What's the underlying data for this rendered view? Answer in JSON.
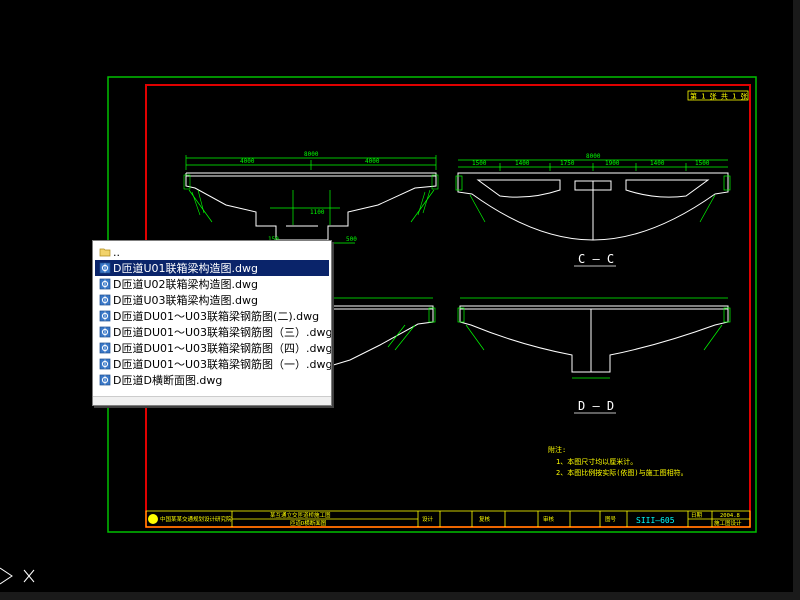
{
  "drawing": {
    "sheet_no": "第 1 张 共 1 张",
    "section_labels": [
      "C — C",
      "D — D"
    ],
    "dims_top_left": [
      "8000",
      "4000",
      "4000",
      "1100",
      "150",
      "500"
    ],
    "dims_top_right": [
      "8000",
      "1500",
      "1400",
      "1750",
      "1900",
      "1400",
      "1500"
    ],
    "notes_title": "附注:",
    "notes": [
      "1、本图尺寸均以厘米计。",
      "2、本图比例按实际(依图)与施工图相符。"
    ],
    "title_block": {
      "company": "中国某某交通规划设计研究院",
      "project": "某互通立交匝道桥施工图",
      "drawing_name": "匝道D横断面图",
      "design": "设计",
      "check": "复核",
      "review": "审核",
      "number_label": "图号",
      "number": "SIII—605",
      "date_label": "日期",
      "date": "2004.8",
      "stage": "施工图设计"
    }
  },
  "file_popup": {
    "items": [
      {
        "label": "..",
        "type": "folder",
        "selected": false
      },
      {
        "label": "D匝道U01联箱梁构造图.dwg",
        "type": "dwg",
        "selected": true
      },
      {
        "label": "D匝道U02联箱梁构造图.dwg",
        "type": "dwg",
        "selected": false
      },
      {
        "label": "D匝道U03联箱梁构造图.dwg",
        "type": "dwg",
        "selected": false
      },
      {
        "label": "D匝道DU01～U03联箱梁钢筋图(二).dwg",
        "type": "dwg",
        "selected": false
      },
      {
        "label": "D匝道DU01～U03联箱梁钢筋图（三）.dwg",
        "type": "dwg",
        "selected": false
      },
      {
        "label": "D匝道DU01～U03联箱梁钢筋图（四）.dwg",
        "type": "dwg",
        "selected": false
      },
      {
        "label": "D匝道DU01～U03联箱梁钢筋图（一）.dwg",
        "type": "dwg",
        "selected": false
      },
      {
        "label": "D匝道D横断面图.dwg",
        "type": "dwg",
        "selected": false
      }
    ]
  },
  "ucs_icon": "ucs-axis-icon",
  "colors": {
    "frame": "#00c000",
    "border": "#e00000",
    "linework": "#ffffff",
    "dims": "#00ff00",
    "notes": "#ffff00",
    "selection": "#0a246a"
  }
}
